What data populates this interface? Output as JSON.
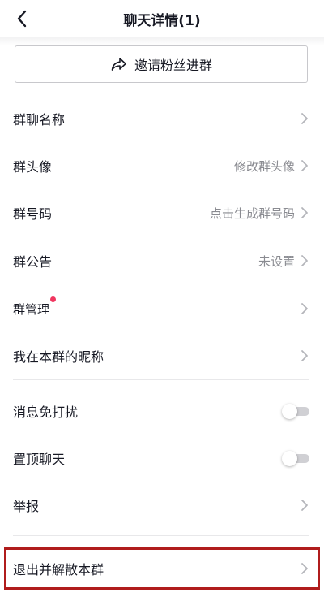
{
  "header": {
    "title": "聊天详情(1)"
  },
  "invite": {
    "label": "邀请粉丝进群"
  },
  "rows": {
    "group_name": {
      "label": "群聊名称"
    },
    "group_avatar": {
      "label": "群头像",
      "value": "修改群头像"
    },
    "group_number": {
      "label": "群号码",
      "value": "点击生成群号码"
    },
    "group_notice": {
      "label": "群公告",
      "value": "未设置"
    },
    "group_manage": {
      "label": "群管理"
    },
    "my_nickname": {
      "label": "我在本群的昵称"
    },
    "mute": {
      "label": "消息免打扰",
      "on": false
    },
    "pin": {
      "label": "置顶聊天",
      "on": false
    },
    "report": {
      "label": "举报"
    },
    "exit": {
      "label": "退出并解散本群"
    }
  },
  "colors": {
    "notification_dot": "#f0365f",
    "highlight_frame": "#b01c1c"
  },
  "icons": {
    "back": "chevron-left-icon",
    "share": "share-arrow-icon",
    "row": "chevron-right-icon"
  }
}
